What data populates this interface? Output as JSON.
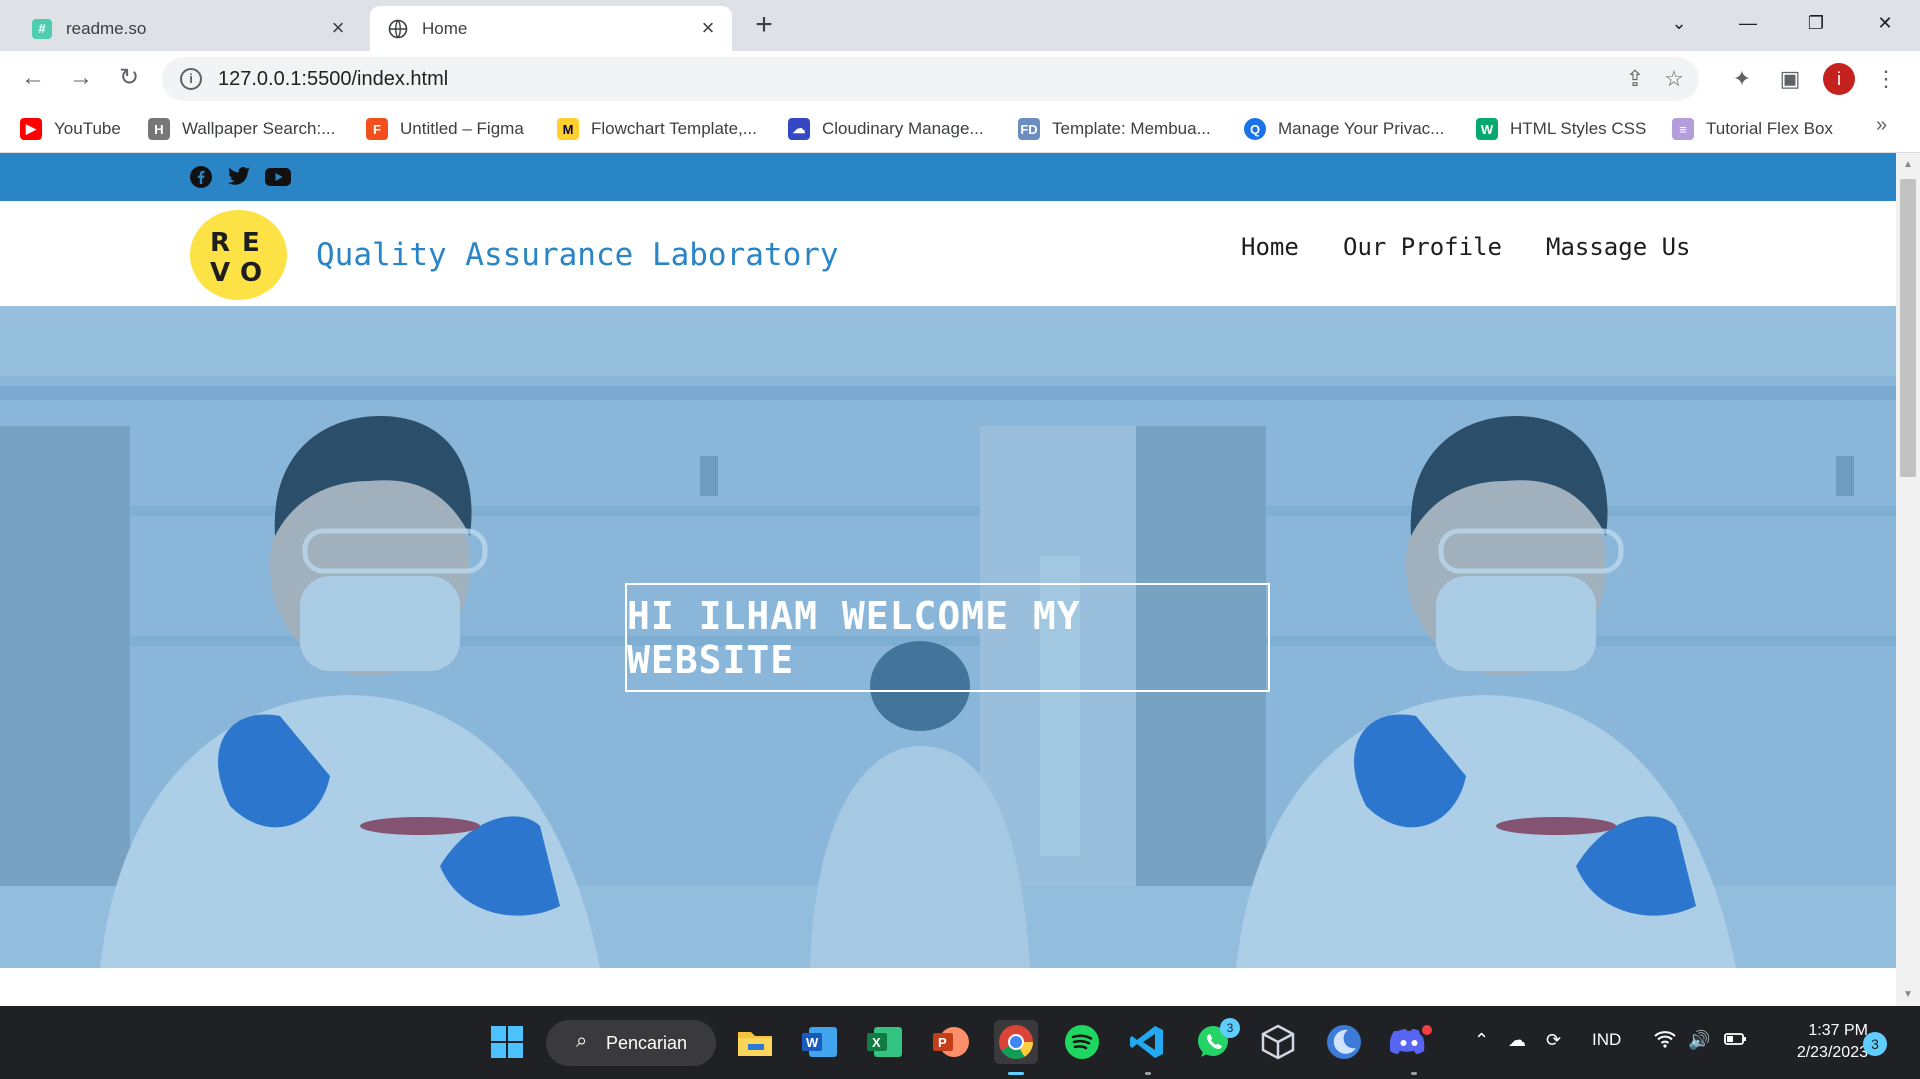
{
  "browser": {
    "tabs": [
      {
        "label": "readme.so",
        "active": false,
        "icon": "readme-favicon-icon"
      },
      {
        "label": "Home",
        "active": true,
        "icon": "globe-icon"
      }
    ],
    "address": "127.0.0.1:5500/index.html",
    "profile_initial": "i",
    "bookmarks": [
      {
        "label": "YouTube",
        "icon": "youtube-icon",
        "color": "#ff0000"
      },
      {
        "label": "Wallpaper Search:...",
        "icon": "wallpaper-icon",
        "color": "#555555"
      },
      {
        "label": "Untitled – Figma",
        "icon": "figma-icon",
        "color": "#f24e1e"
      },
      {
        "label": "Flowchart Template,...",
        "icon": "miro-icon",
        "color": "#ffd02f"
      },
      {
        "label": "Cloudinary Manage...",
        "icon": "cloudinary-icon",
        "color": "#3448c5"
      },
      {
        "label": "Template: Membua...",
        "icon": "fd-icon",
        "color": "#6c8ebf"
      },
      {
        "label": "Manage Your Privac...",
        "icon": "privacy-icon",
        "color": "#1a73e8"
      },
      {
        "label": "HTML Styles CSS",
        "icon": "w3schools-icon",
        "color": "#04aa6d"
      },
      {
        "label": "Tutorial Flex Box",
        "icon": "flexbox-icon",
        "color": "#b39ddb"
      }
    ]
  },
  "site": {
    "logo_letters": [
      "R",
      "E",
      "V",
      "O"
    ],
    "title": "Quality Assurance Laboratory",
    "nav": [
      "Home",
      "Our Profile",
      "Massage Us"
    ],
    "hero_text": "HI ILHAM WELCOME MY WEBSITE",
    "social": [
      "facebook-icon",
      "twitter-icon",
      "youtube-icon"
    ],
    "colors": {
      "brand": "#2a85c6",
      "logo_bg": "#fde245"
    }
  },
  "taskbar": {
    "search_label": "Pencarian",
    "whatsapp_badge": "3",
    "language": "IND",
    "time": "1:37 PM",
    "date": "2/23/2023",
    "notifications": "3"
  }
}
